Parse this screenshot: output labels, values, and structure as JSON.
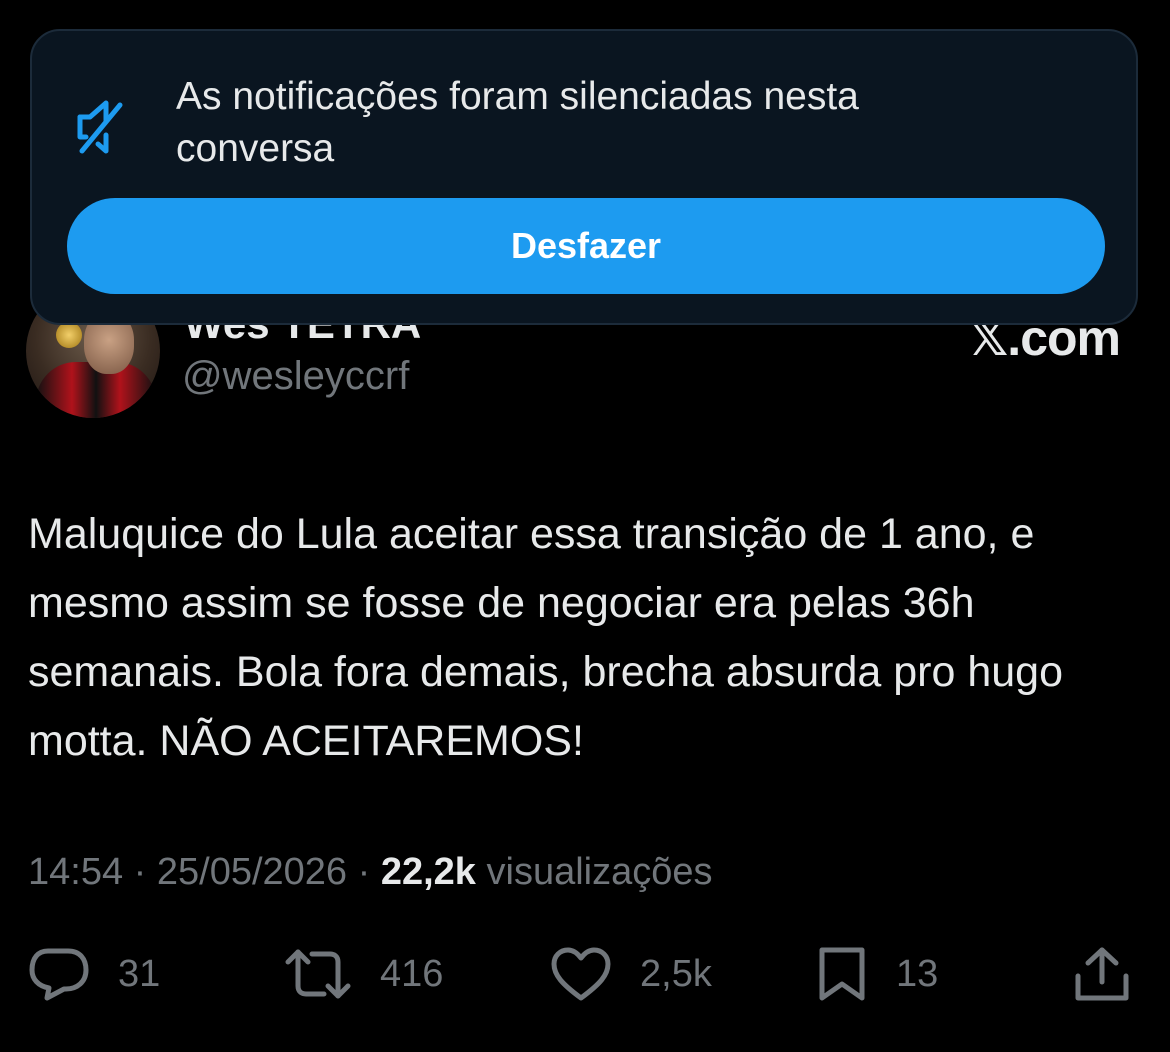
{
  "toast": {
    "message": "As notificações foram silenciadas nesta conversa",
    "undo_label": "Desfazer",
    "icon": "speaker-muted-icon",
    "accent_color": "#1d9bf0"
  },
  "tweet": {
    "display_name": "Wes TETRA",
    "handle": "@wesleyccrf",
    "brand": "𝕏.com",
    "text": "Maluquice do Lula aceitar essa transição de 1 ano, e mesmo assim se fosse de negociar era pelas 36h semanais. Bola fora demais, brecha absurda pro hugo motta. NÃO ACEITAREMOS!",
    "time": "14:54",
    "date": "25/05/2026",
    "separator": "·",
    "views_count": "22,2k",
    "views_label": "visualizações"
  },
  "actions": {
    "replies": "31",
    "retweets": "416",
    "likes": "2,5k",
    "bookmarks": "13"
  }
}
